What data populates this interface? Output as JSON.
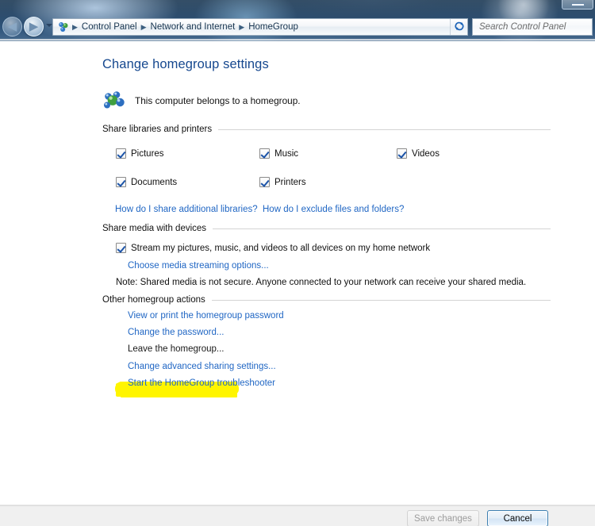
{
  "window": {
    "nav": {
      "back_label": "◀",
      "forward_label": "▶",
      "recent_pages_label": "Recent pages"
    },
    "address_bar": {
      "icon": "control-panel-icon",
      "separator": "▶",
      "breadcrumbs": [
        "Control Panel",
        "Network and Internet",
        "HomeGroup"
      ],
      "dropdown_label": "Previous locations"
    },
    "refresh": {
      "label": "↻",
      "title": "Refresh"
    },
    "search": {
      "value": "",
      "placeholder": "Search Control Panel"
    },
    "window_control": {
      "label": "Restore"
    }
  },
  "page": {
    "title": "Change homegroup settings",
    "status": {
      "icon": "homegroup-icon",
      "text": "This computer belongs to a homegroup."
    },
    "sections": {
      "share_libraries": {
        "heading": "Share libraries and printers",
        "checkboxes": [
          {
            "label": "Pictures",
            "checked": true
          },
          {
            "label": "Music",
            "checked": true
          },
          {
            "label": "Videos",
            "checked": true
          },
          {
            "label": "Documents",
            "checked": true
          },
          {
            "label": "Printers",
            "checked": true
          }
        ],
        "links": [
          "How do I share additional libraries?",
          "How do I exclude files and folders?"
        ]
      },
      "share_media": {
        "heading": "Share media with devices",
        "stream_checkbox": {
          "label": "Stream my pictures, music, and videos to all devices on my home network",
          "checked": true
        },
        "streaming_options_link": "Choose media streaming options...",
        "note": "Note: Shared media is not secure. Anyone connected to your network can receive your shared media."
      },
      "other_actions": {
        "heading": "Other homegroup actions",
        "links": [
          "View or print the homegroup password",
          "Change the password...",
          "Leave the homegroup...",
          "Change advanced sharing settings...",
          "Start the HomeGroup troubleshooter"
        ]
      }
    },
    "annotation": {
      "highlighted_link": "Leave the homegroup...",
      "highlight_color": "#fff500"
    }
  },
  "footer": {
    "save_label": "Save changes",
    "save_disabled": true,
    "cancel_label": "Cancel"
  },
  "colors": {
    "link": "#2167c4",
    "title": "#16488f",
    "highlight": "#fff500",
    "focus_border": "#3c7fb1"
  }
}
